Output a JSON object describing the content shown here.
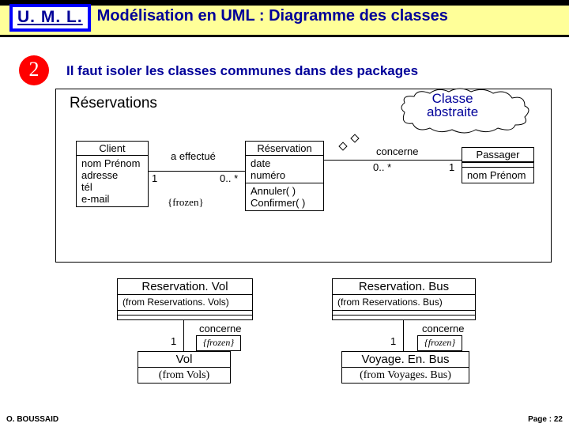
{
  "header": {
    "logo": "U. M. L.",
    "title": "Modélisation en UML : Diagramme des classes"
  },
  "step": "2",
  "subtitle": "Il faut isoler les classes communes dans des packages",
  "package_label": "Réservations",
  "cloud": {
    "l1": "Classe",
    "l2": "abstraite"
  },
  "client": {
    "name": "Client",
    "a1": "nom Prénom",
    "a2": "adresse",
    "a3": "tél",
    "a4": "e-mail"
  },
  "reservation": {
    "name": "Réservation",
    "a1": "date",
    "a2": "numéro",
    "m1": "Annuler( )",
    "m2": "Confirmer( )"
  },
  "passager": {
    "name": "Passager",
    "a1": "nom Prénom"
  },
  "assoc1": {
    "name": "a effectué",
    "left": "1",
    "right": "0.. *",
    "constraint": "{frozen}"
  },
  "assoc2": {
    "name": "concerne",
    "left": "0.. *",
    "right": "1"
  },
  "resvol": {
    "name": "Reservation. Vol",
    "from": "(from Reservations. Vols)"
  },
  "resbus": {
    "name": "Reservation. Bus",
    "from": "(from Reservations. Bus)"
  },
  "vol": {
    "name": "Vol",
    "from": "(from Vols)"
  },
  "bus": {
    "name": "Voyage. En. Bus",
    "from": "(from Voyages. Bus)"
  },
  "assoc3": {
    "name": "concerne",
    "left": "1",
    "constraint": "{frozen}"
  },
  "assoc4": {
    "name": "concerne",
    "left": "1",
    "constraint": "{frozen}"
  },
  "footer": {
    "left": "O. BOUSSAID",
    "right": "Page : 22"
  }
}
